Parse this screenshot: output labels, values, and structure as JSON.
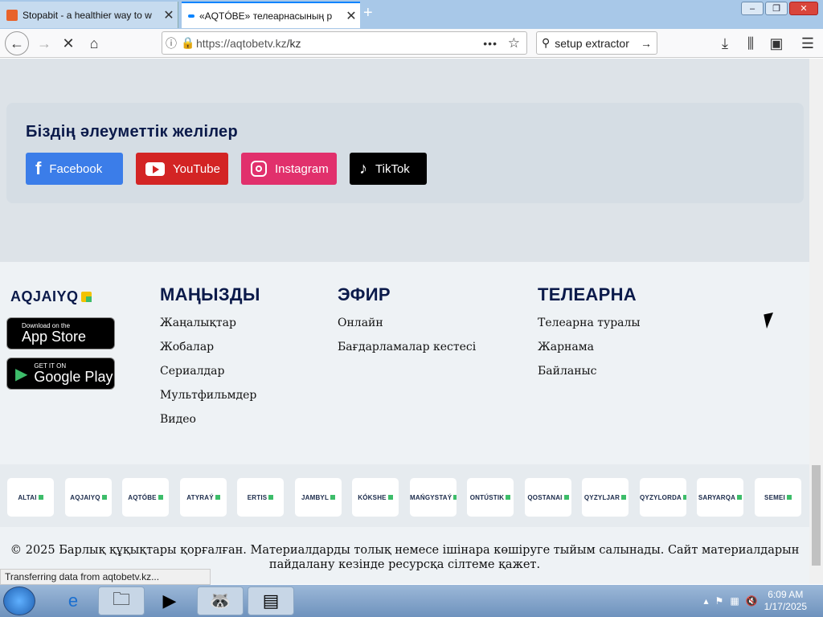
{
  "browser": {
    "tabs": [
      {
        "title": "Stopabit - a healthier way to w",
        "favicon_color": "#e8632b"
      },
      {
        "title": "«AQTÓBE» телеарнасының р",
        "favicon_color": "#0a84ff"
      }
    ],
    "url_host": "https://aqtobetv.kz",
    "url_path": "/kz",
    "search_text": "setup extractor"
  },
  "social": {
    "heading": "Біздің әлеуметтік желілер",
    "buttons": [
      {
        "label": "Facebook",
        "color": "#3b7de9"
      },
      {
        "label": "YouTube",
        "color": "#d32424"
      },
      {
        "label": "Instagram",
        "color": "#e1306c"
      },
      {
        "label": "TikTok",
        "color": "#000000"
      }
    ]
  },
  "footer": {
    "logo": "AQJAIYQ",
    "app_store": {
      "small": "Download on the",
      "big": "App Store"
    },
    "google_play": {
      "small": "GET IT ON",
      "big": "Google Play"
    },
    "columns": [
      {
        "title": "МАҢЫЗДЫ",
        "links": [
          "Жаңалықтар",
          "Жобалар",
          "Сериалдар",
          "Мультфильмдер",
          "Видео"
        ]
      },
      {
        "title": "ЭФИР",
        "links": [
          "Онлайн",
          "Бағдарламалар кестесі"
        ]
      },
      {
        "title": "ТЕЛЕАРНА",
        "links": [
          "Телеарна туралы",
          "Жарнама",
          "Байланыс"
        ]
      }
    ],
    "channels": [
      "ALTAI",
      "AQJAIYQ",
      "AQTÓBE",
      "ATYRAÝ",
      "ERTIS",
      "JAMBYL",
      "KÓKSHE",
      "MAŃGYSTAÝ",
      "ONTÚSTIK",
      "QOSTANAI",
      "QYZYLJAR",
      "QYZYLORDA",
      "SARYARQA",
      "SEMEI"
    ],
    "copyright": "© 2025 Барлық құқықтары қорғалған. Материалдарды толық немесе ішінара көшіруге тыйым салынады. Сайт материалдарын пайдалану кезінде ресурсқа сілтеме қажет."
  },
  "status_bar": "Transferring data from aqtobetv.kz...",
  "taskbar": {
    "time": "6:09 AM",
    "date": "1/17/2025"
  }
}
